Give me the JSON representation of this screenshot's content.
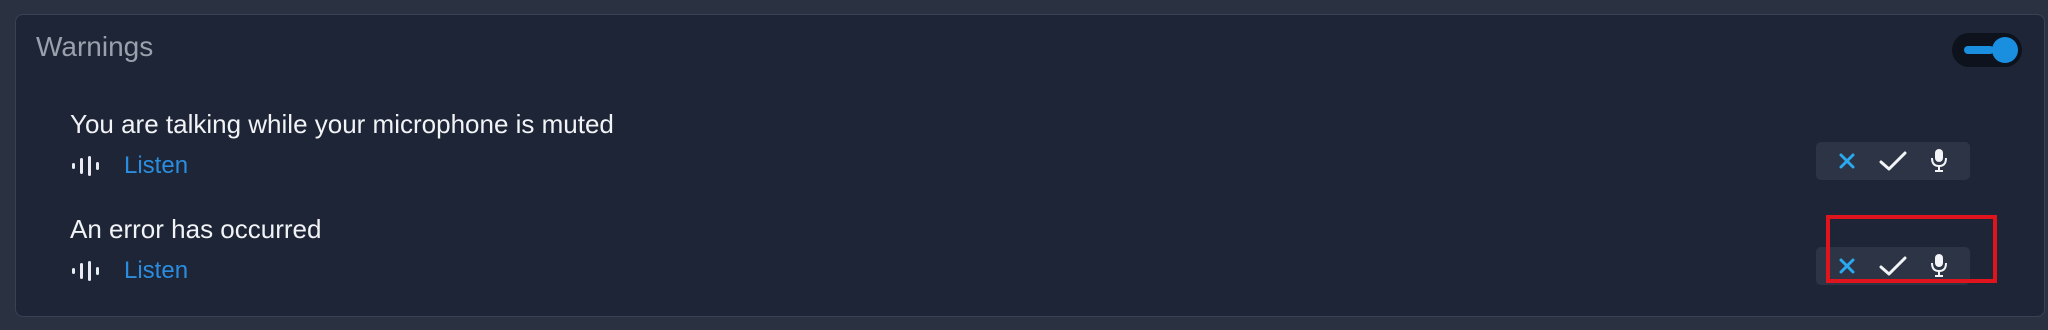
{
  "section": {
    "title": "Warnings",
    "toggle_enabled": true
  },
  "warnings": [
    {
      "text": "You are talking while your microphone is muted",
      "listen_label": "Listen",
      "actions": [
        "dismiss-icon",
        "check-icon",
        "microphone-icon"
      ]
    },
    {
      "text": "An error has occurred",
      "listen_label": "Listen",
      "actions": [
        "dismiss-icon",
        "check-icon",
        "microphone-icon"
      ]
    }
  ],
  "colors": {
    "background": "#2a3141",
    "panel": "#1e2536",
    "accent": "#1a8fe0",
    "link": "#2b8de0",
    "highlight": "#e0141c"
  }
}
